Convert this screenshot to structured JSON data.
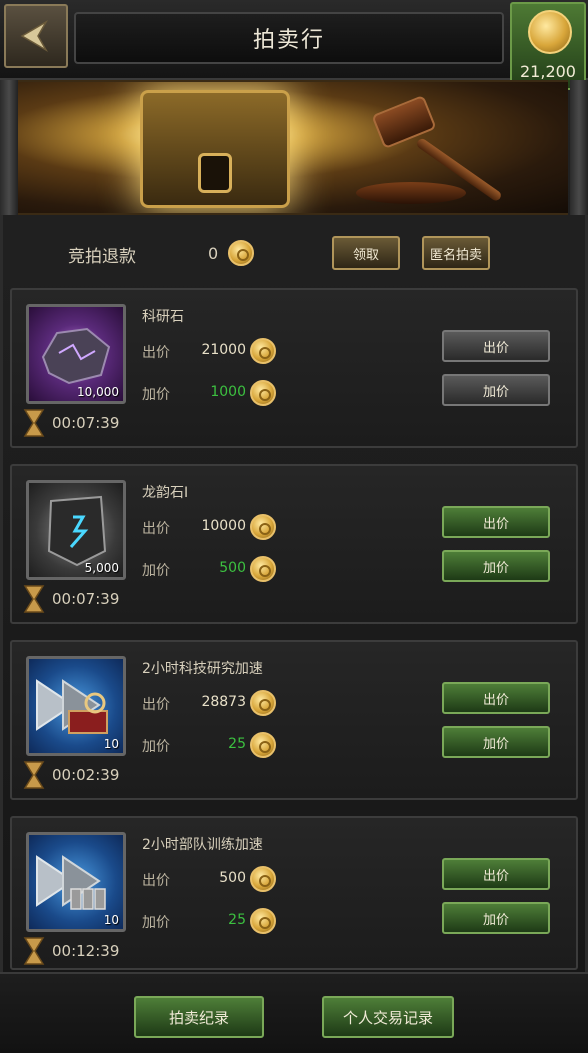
{
  "header": {
    "title": "拍卖行",
    "gold_amount": "21,200"
  },
  "refund": {
    "label": "竞拍退款",
    "value": "0",
    "claim_label": "领取",
    "anonymous_label": "匿名拍卖"
  },
  "items": [
    {
      "name": "科研石",
      "quantity": "10,000",
      "bid_label": "出价",
      "bid_value": "21000",
      "raise_label": "加价",
      "raise_value": "1000",
      "timer": "00:07:39",
      "bid_button": "出价",
      "raise_button": "加价",
      "button_style": "gray",
      "icon": "purple-ore-icon"
    },
    {
      "name": "龙韵石I",
      "quantity": "5,000",
      "bid_label": "出价",
      "bid_value": "10000",
      "raise_label": "加价",
      "raise_value": "500",
      "timer": "00:07:39",
      "bid_button": "出价",
      "raise_button": "加价",
      "button_style": "green",
      "icon": "dragon-rune-stone-icon"
    },
    {
      "name": "2小时科技研究加速",
      "quantity": "10",
      "bid_label": "出价",
      "bid_value": "28873",
      "raise_label": "加价",
      "raise_value": "25",
      "timer": "00:02:39",
      "bid_button": "出价",
      "raise_button": "加价",
      "button_style": "green",
      "icon": "research-speedup-icon"
    },
    {
      "name": "2小时部队训练加速",
      "quantity": "10",
      "bid_label": "出价",
      "bid_value": "500",
      "raise_label": "加价",
      "raise_value": "25",
      "timer": "00:12:39",
      "bid_button": "出价",
      "raise_button": "加价",
      "button_style": "green",
      "icon": "training-speedup-icon"
    }
  ],
  "footer": {
    "auction_record": "拍卖纪录",
    "trade_record": "个人交易记录"
  },
  "colors": {
    "accent_green": "#4e7e38",
    "price_green": "#3cc040",
    "gold": "#d8a63a"
  }
}
